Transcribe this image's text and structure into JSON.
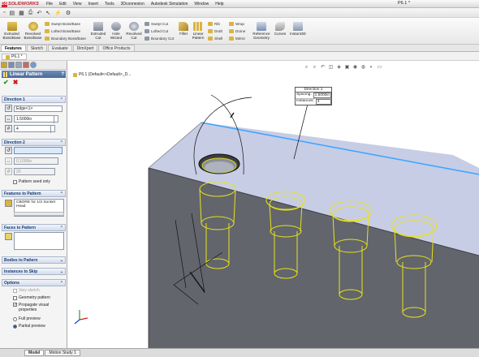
{
  "app": {
    "brand": "SOLIDWORKS",
    "doc_title": "P6.1 *"
  },
  "menu": [
    "File",
    "Edit",
    "View",
    "Insert",
    "Tools",
    "3Dconnexion",
    "Autodesk Simulation",
    "Window",
    "Help"
  ],
  "ribbon": {
    "extruded_boss": "Extruded Boss/Base",
    "revolved_boss": "Revolved Boss/Base",
    "swept_boss": "Swept Boss/Base",
    "lofted_boss": "Lofted Boss/Base",
    "boundary_boss": "Boundary Boss/Base",
    "extruded_cut": "Extruded Cut",
    "hole_wizard": "Hole Wizard",
    "revolved_cut": "Revolved Cut",
    "swept_cut": "Swept Cut",
    "lofted_cut": "Lofted Cut",
    "boundary_cut": "Boundary Cut",
    "fillet": "Fillet",
    "linear_pattern": "Linear Pattern",
    "rib": "Rib",
    "draft": "Draft",
    "shell": "Shell",
    "wrap": "Wrap",
    "dome": "Dome",
    "mirror": "Mirror",
    "reference_geometry": "Reference Geometry",
    "curves": "Curves",
    "instant3d": "Instant3D"
  },
  "command_tabs": [
    "Features",
    "Sketch",
    "Evaluate",
    "DimXpert",
    "Office Products"
  ],
  "document_tab": "P6.1 *",
  "property_manager": {
    "title": "Linear Pattern",
    "direction1": {
      "header": "Direction 1",
      "edge": "Edge<1>",
      "spacing": "1.5000in",
      "instances": "4"
    },
    "direction2": {
      "header": "Direction 2",
      "edge": "",
      "spacing": "0.1000in",
      "instances": "20",
      "pattern_seed_only": "Pattern seed only"
    },
    "features_to_pattern": {
      "header": "Features to Pattern",
      "item": "CBORE for 1/2 Socket Head"
    },
    "faces_to_pattern": {
      "header": "Faces to Pattern"
    },
    "bodies_to_pattern": {
      "header": "Bodies to Pattern"
    },
    "instances_to_skip": {
      "header": "Instances to Skip"
    },
    "options": {
      "header": "Options",
      "vary_sketch": "Vary sketch",
      "geometry_pattern": "Geometry pattern",
      "propagate_visual": "Propagate visual properties",
      "full_preview": "Full preview",
      "partial_preview": "Partial preview"
    }
  },
  "viewport": {
    "tree_label": "P6.1 (Default<<Default>_D...",
    "callout": {
      "title": "Direction 1",
      "spacing_label": "Spacing:",
      "spacing_value": "1.5000in",
      "instances_label": "Instances:",
      "instances_value": "4"
    }
  },
  "bottom_tabs": [
    "Model",
    "Motion Study 1"
  ],
  "colors": {
    "accent": "#4a6a98",
    "block_top": "#c7cde6",
    "block_front": "#63666d",
    "block_side": "#44474d",
    "pattern_preview": "#e6e21a",
    "selected_edge": "#3fa6ff"
  }
}
